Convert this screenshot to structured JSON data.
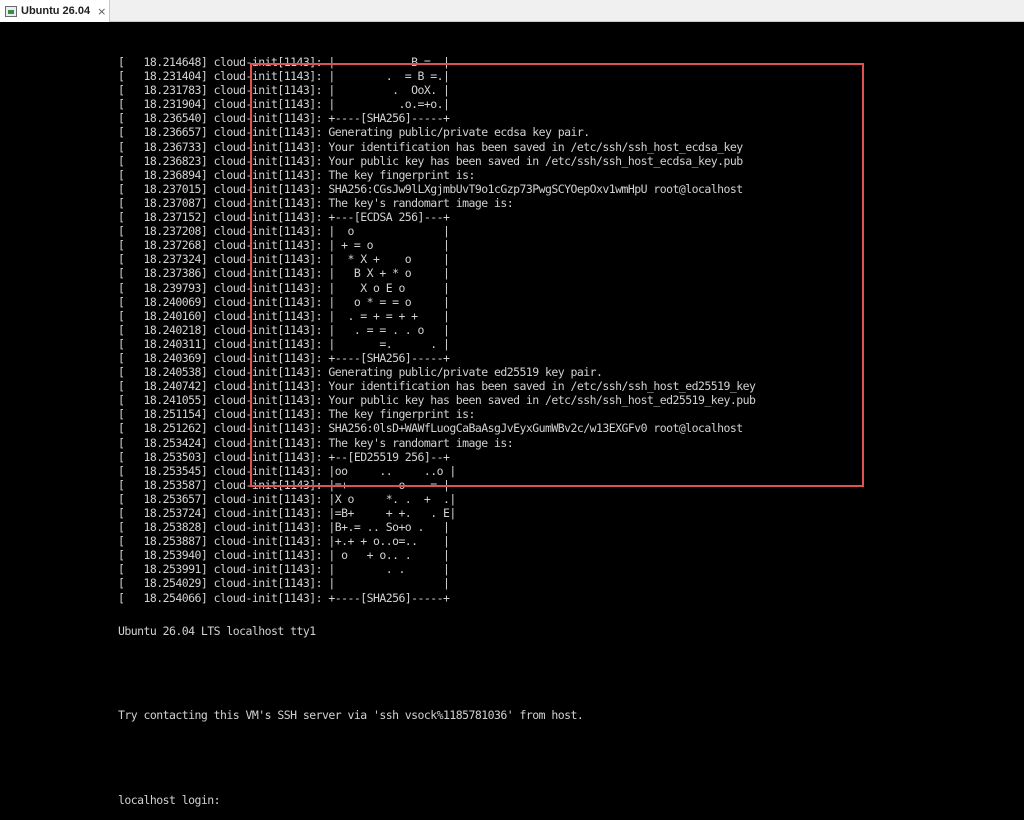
{
  "window": {
    "tab_title": "Ubuntu 26.04",
    "close_glyph": "×"
  },
  "console": {
    "lines": [
      "[   18.214648] cloud-init[1143]: |            B =  |",
      "[   18.231404] cloud-init[1143]: |        .  = B =.|",
      "[   18.231783] cloud-init[1143]: |         .  OoX. |",
      "[   18.231904] cloud-init[1143]: |          .o.=+o.|",
      "[   18.236540] cloud-init[1143]: +----[SHA256]-----+",
      "[   18.236657] cloud-init[1143]: Generating public/private ecdsa key pair.",
      "[   18.236733] cloud-init[1143]: Your identification has been saved in /etc/ssh/ssh_host_ecdsa_key",
      "[   18.236823] cloud-init[1143]: Your public key has been saved in /etc/ssh/ssh_host_ecdsa_key.pub",
      "[   18.236894] cloud-init[1143]: The key fingerprint is:",
      "[   18.237015] cloud-init[1143]: SHA256:CGsJw9lLXgjmbUvT9o1cGzp73PwgSCYOepOxv1wmHpU root@localhost",
      "[   18.237087] cloud-init[1143]: The key's randomart image is:",
      "[   18.237152] cloud-init[1143]: +---[ECDSA 256]---+",
      "[   18.237208] cloud-init[1143]: |  o              |",
      "[   18.237268] cloud-init[1143]: | + = o           |",
      "[   18.237324] cloud-init[1143]: |  * X +    o     |",
      "[   18.237386] cloud-init[1143]: |   B X + * o     |",
      "[   18.239793] cloud-init[1143]: |    X o E o      |",
      "[   18.240069] cloud-init[1143]: |   o * = = o     |",
      "[   18.240160] cloud-init[1143]: |  . = + = + +    |",
      "[   18.240218] cloud-init[1143]: |   . = = . . o   |",
      "[   18.240311] cloud-init[1143]: |       =.      . |",
      "[   18.240369] cloud-init[1143]: +----[SHA256]-----+",
      "[   18.240538] cloud-init[1143]: Generating public/private ed25519 key pair.",
      "[   18.240742] cloud-init[1143]: Your identification has been saved in /etc/ssh/ssh_host_ed25519_key",
      "[   18.241055] cloud-init[1143]: Your public key has been saved in /etc/ssh/ssh_host_ed25519_key.pub",
      "[   18.251154] cloud-init[1143]: The key fingerprint is:",
      "[   18.251262] cloud-init[1143]: SHA256:0lsD+WAWfLuogCaBaAsgJvEyxGumWBv2c/w13EXGFv0 root@localhost",
      "[   18.253424] cloud-init[1143]: The key's randomart image is:",
      "[   18.253503] cloud-init[1143]: +--[ED25519 256]--+",
      "[   18.253545] cloud-init[1143]: |oo     ..     ..o |",
      "[   18.253587] cloud-init[1143]: |=+        o    = |",
      "[   18.253657] cloud-init[1143]: |X o     *. .  +  .|",
      "[   18.253724] cloud-init[1143]: |=B+     + +.   . E|",
      "[   18.253828] cloud-init[1143]: |B+.= .. So+o .   |",
      "[   18.253887] cloud-init[1143]: |+.+ + o..o=..    |",
      "[   18.253940] cloud-init[1143]: | o   + o.. .     |",
      "[   18.253991] cloud-init[1143]: |        . .      |",
      "[   18.254029] cloud-init[1143]: |                 |",
      "[   18.254066] cloud-init[1143]: +----[SHA256]-----+"
    ],
    "banner": "Ubuntu 26.04 LTS localhost tty1",
    "ssh_hint": "Try contacting this VM's SSH server via 'ssh vsock%1185781036' from host.",
    "login_prompt": "localhost login:"
  },
  "annotation": {
    "box_color": "#e05252"
  }
}
